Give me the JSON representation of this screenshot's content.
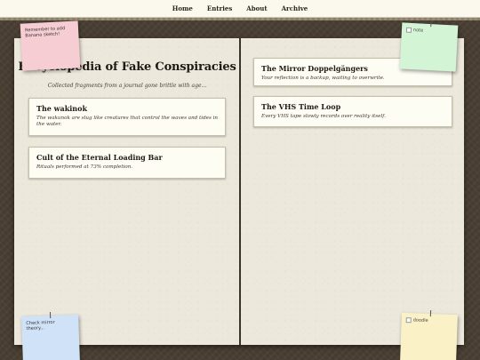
{
  "nav": {
    "items": [
      "Home",
      "Entries",
      "About",
      "Archive"
    ]
  },
  "journal": {
    "title": "Encyclopedia of Fake Conspiracies",
    "subtitle": "Collected fragments from a journal gone brittle with age..."
  },
  "entries_left": [
    {
      "title": "The wakinok",
      "description": "The wakunok are slug like creatures that control the waves and tides in the water."
    },
    {
      "title": "Cult of the Eternal Loading Bar",
      "description": "Rituals performed at 73% completion."
    }
  ],
  "entries_right": [
    {
      "title": "The Mirror Doppelgängers",
      "description": "Your reflection is a backup, waiting to overwrite."
    },
    {
      "title": "The VHS Time Loop",
      "description": "Every VHS tape slowly records over reality itself."
    }
  ],
  "stickies": {
    "pink_text": "Remember to add Banana sketch!",
    "green_alt": "note",
    "blue_text": "Check mirror theory...",
    "yellow_alt": "doodle"
  },
  "colors": {
    "background": "#4a3f33",
    "page": "#ece8dc",
    "card": "#fefdf4",
    "sticky_pink": "#f7cdd4",
    "sticky_green": "#d3f5d6",
    "sticky_blue": "#d0e2f7",
    "sticky_yellow": "#faf1c7"
  }
}
